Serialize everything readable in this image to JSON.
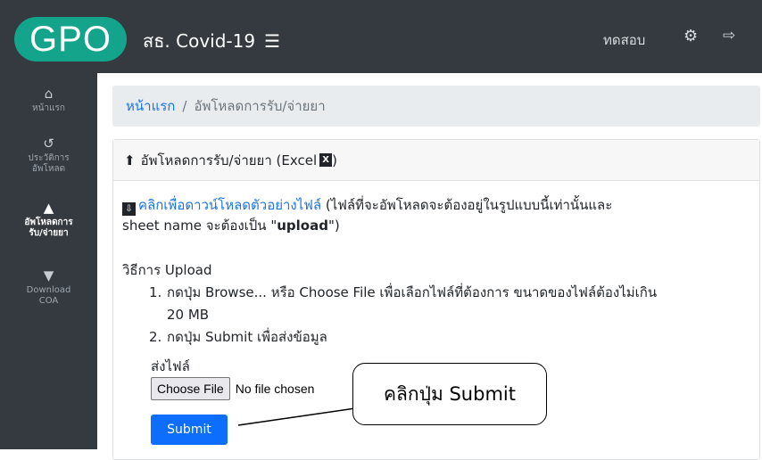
{
  "topbar": {
    "logo_text": "GPO",
    "brand_title": "สธ. Covid-19",
    "menu_icon": "☰",
    "user_name": "ทดสอบ",
    "settings_icon": "⚙",
    "logout_icon": "⇨"
  },
  "sidebar": {
    "items": [
      {
        "icon": "⌂",
        "label_line1": "หน้าแรก",
        "label_line2": "",
        "active": false
      },
      {
        "icon": "↺",
        "label_line1": "ประวัติการ",
        "label_line2": "อัพโหลด",
        "active": false
      },
      {
        "icon": "▲",
        "label_line1": "อัพโหลดการ",
        "label_line2": "รับ/จ่ายยา",
        "active": true
      },
      {
        "icon": "▼",
        "label_line1": "Download",
        "label_line2": "COA",
        "active": false
      }
    ]
  },
  "breadcrumb": {
    "home": "หน้าแรก",
    "separator": "/",
    "current": "อัพโหลดการรับ/จ่ายยา"
  },
  "card": {
    "header_icon": "⬆",
    "header_title": "อัพโหลดการรับ/จ่ายยา (Excel",
    "header_end": ")",
    "xls_icon": "X",
    "download_icon": "⇩",
    "download_link": "คลิกเพื่อดาวน์โหลดตัวอย่างไฟล์",
    "download_note_1": " (ไฟล์ที่จะอัพโหลดจะต้องอยู่ในรูปแบบนี้เท่านั้นและ",
    "download_note_2_pre": "sheet name จะต้องเป็น \"",
    "download_note_2_bold": "upload",
    "download_note_2_post": "\")",
    "method_title": "วิธีการ Upload",
    "step1_num": "1.",
    "step1_text": "กดปุ่ม Browse... หรือ Choose File เพื่อเลือกไฟล์ที่ต้องการ ขนาดของไฟล์ต้องไม่เกิน",
    "step1_cont": "20 MB",
    "step2_num": "2.",
    "step2_text": "กดปุ่ม Submit เพื่อส่งข้อมูล",
    "send_label": "ส่งไฟล์",
    "choose_file": "Choose File",
    "no_file": "No file chosen",
    "submit": "Submit"
  },
  "callout": {
    "text": "คลิกปุ่ม Submit"
  },
  "colors": {
    "topbar": "#343a40",
    "logo": "#14a38b",
    "link": "#1a73e8",
    "submit": "#0d6efd"
  }
}
